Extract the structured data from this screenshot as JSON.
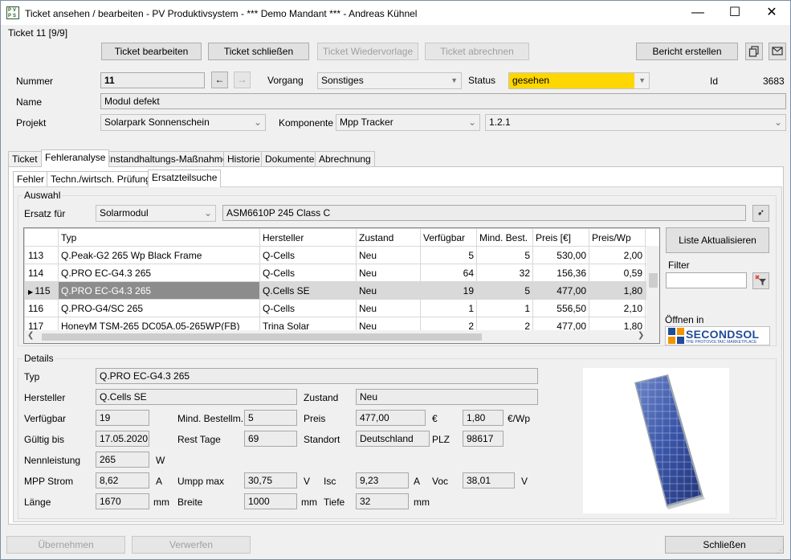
{
  "window": {
    "title": "Ticket ansehen / bearbeiten - PV Produktivsystem - *** Demo Mandant *** - Andreas Kühnel",
    "minimize": "—",
    "maximize": "☐",
    "close": "✕"
  },
  "ticket_counter": "Ticket 11 [9/9]",
  "toolbar": {
    "edit": "Ticket bearbeiten",
    "close_ticket": "Ticket schließen",
    "resubmit": "Ticket Wiedervorlage",
    "bill": "Ticket abrechnen",
    "report": "Bericht erstellen"
  },
  "header": {
    "nummer_label": "Nummer",
    "nummer_value": "11",
    "vorgang_label": "Vorgang",
    "vorgang_value": "Sonstiges",
    "status_label": "Status",
    "status_value": "gesehen",
    "status_color": "#ffd700",
    "id_label": "Id",
    "id_value": "3683",
    "name_label": "Name",
    "name_value": "Modul defekt",
    "projekt_label": "Projekt",
    "projekt_value": "Solarpark Sonnenschein",
    "komponente_label": "Komponente",
    "komponente_value": "Mpp Tracker",
    "komponente_detail": "1.2.1"
  },
  "tabs": [
    "Ticket",
    "Fehleranalyse",
    "Instandhaltungs-Maßnahmen",
    "Historie",
    "Dokumente",
    "Abrechnung"
  ],
  "subtabs": [
    "Fehler",
    "Techn./wirtsch. Prüfung",
    "Ersatzteilsuche"
  ],
  "auswahl": {
    "title": "Auswahl",
    "ersatz_label": "Ersatz für",
    "ersatz_value": "Solarmodul",
    "ersatz_detail": "ASM6610P 245 Class C"
  },
  "grid": {
    "columns": [
      "Typ",
      "Hersteller",
      "Zustand",
      "Verfügbar",
      "Mind. Best.",
      "Preis [€]",
      "Preis/Wp"
    ],
    "rows": [
      {
        "nr": "113",
        "typ": "Q.Peak-G2 265 Wp Black Frame",
        "hersteller": "Q-Cells",
        "zustand": "Neu",
        "verfuegbar": "5",
        "mind": "5",
        "preis": "530,00",
        "wp": "2,00"
      },
      {
        "nr": "114",
        "typ": "Q.PRO EC-G4.3 265",
        "hersteller": "Q-Cells",
        "zustand": "Neu",
        "verfuegbar": "64",
        "mind": "32",
        "preis": "156,36",
        "wp": "0,59"
      },
      {
        "nr": "115",
        "typ": "Q.PRO EC-G4.3 265",
        "hersteller": "Q.Cells SE",
        "zustand": "Neu",
        "verfuegbar": "19",
        "mind": "5",
        "preis": "477,00",
        "wp": "1,80"
      },
      {
        "nr": "116",
        "typ": "Q.PRO-G4/SC 265",
        "hersteller": "Q-Cells",
        "zustand": "Neu",
        "verfuegbar": "1",
        "mind": "1",
        "preis": "556,50",
        "wp": "2,10"
      },
      {
        "nr": "117",
        "typ": "HoneyM TSM-265 DC05A.05-265WP(FB)",
        "hersteller": "Trina Solar",
        "zustand": "Neu",
        "verfuegbar": "2",
        "mind": "2",
        "preis": "477,00",
        "wp": "1,80"
      }
    ],
    "selected_row": "115"
  },
  "right_panel": {
    "refresh": "Liste Aktualisieren",
    "filter_label": "Filter",
    "filter_value": "",
    "open_in": "Öffnen in",
    "logo_text": "SECONDSOL",
    "logo_sub": "THE PHOTOVOLTAIC MARKETPLACE"
  },
  "details": {
    "title": "Details",
    "typ_label": "Typ",
    "typ": "Q.PRO EC-G4.3 265",
    "hersteller_label": "Hersteller",
    "hersteller": "Q.Cells SE",
    "zustand_label": "Zustand",
    "zustand": "Neu",
    "verfuegbar_label": "Verfügbar",
    "verfuegbar": "19",
    "mind_label": "Mind. Bestellm.",
    "mind": "5",
    "preis_label": "Preis",
    "preis": "477,00",
    "preis_unit": "€",
    "preis_wp": "1,80",
    "preis_wp_unit": "€/Wp",
    "gueltig_label": "Gültig bis",
    "gueltig": "17.05.2020",
    "resttage_label": "Rest Tage",
    "resttage": "69",
    "standort_label": "Standort",
    "standort": "Deutschland",
    "plz_label": "PLZ",
    "plz": "98617",
    "nenn_label": "Nennleistung",
    "nenn": "265",
    "nenn_unit": "W",
    "mpp_label": "MPP Strom",
    "mpp": "8,62",
    "mpp_unit": "A",
    "umpp_label": "Umpp max",
    "umpp": "30,75",
    "umpp_unit": "V",
    "isc_label": "Isc",
    "isc": "9,23",
    "isc_unit": "A",
    "voc_label": "Voc",
    "voc": "38,01",
    "voc_unit": "V",
    "laenge_label": "Länge",
    "laenge": "1670",
    "laenge_unit": "mm",
    "breite_label": "Breite",
    "breite": "1000",
    "breite_unit": "mm",
    "tiefe_label": "Tiefe",
    "tiefe": "32",
    "tiefe_unit": "mm"
  },
  "footer": {
    "apply": "Übernehmen",
    "discard": "Verwerfen",
    "close": "Schließen"
  }
}
